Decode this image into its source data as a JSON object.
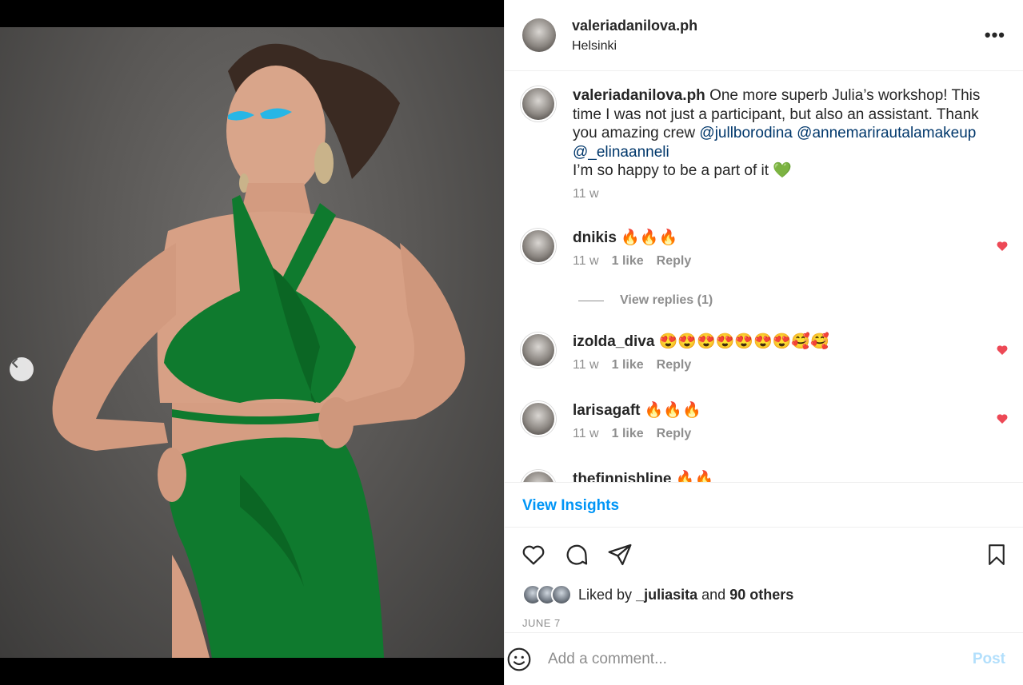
{
  "header": {
    "username": "valeriadanilova.ph",
    "location": "Helsinki",
    "more_icon": "more-horizontal-icon",
    "more_glyph": "•••"
  },
  "caption": {
    "username": "valeriadanilova.ph",
    "text": "One more superb Julia’s workshop! This time I was not just a participant, but also an assistant. Thank you amazing crew",
    "mentions": [
      "@jullborodina",
      "@annemarirautalamakeup",
      "@_elinaanneli"
    ],
    "line2": "I’m so happy to be a part of it 💚",
    "time": "11 w"
  },
  "comments": [
    {
      "username": "dnikis",
      "text": "🔥🔥🔥",
      "time": "11 w",
      "likes": "1 like",
      "reply": "Reply"
    },
    {
      "username": "izolda_diva",
      "text": "😍😍😍😍😍😍😍🥰🥰",
      "time": "11 w",
      "likes": "1 like",
      "reply": "Reply"
    },
    {
      "username": "larisagaft",
      "text": "🔥🔥🔥",
      "time": "11 w",
      "likes": "1 like",
      "reply": "Reply"
    },
    {
      "username": "thefinnishline",
      "text": "🔥🔥",
      "time": "",
      "likes": "",
      "reply": ""
    }
  ],
  "view_replies": "View replies (1)",
  "insights_label": "View Insights",
  "likes": {
    "prefix": "Liked by",
    "user": "_juliasita",
    "mid": "and",
    "others": "90 others"
  },
  "date": "JUNE 7",
  "add_comment": {
    "placeholder": "Add a comment...",
    "post_label": "Post"
  },
  "colors": {
    "link": "#0095f6",
    "mention": "#00376b",
    "heart": "#ed4956",
    "muted": "#8e8e8e",
    "dress": "#0f7a2e"
  },
  "carousel": {
    "slides": 3,
    "active": 3
  }
}
